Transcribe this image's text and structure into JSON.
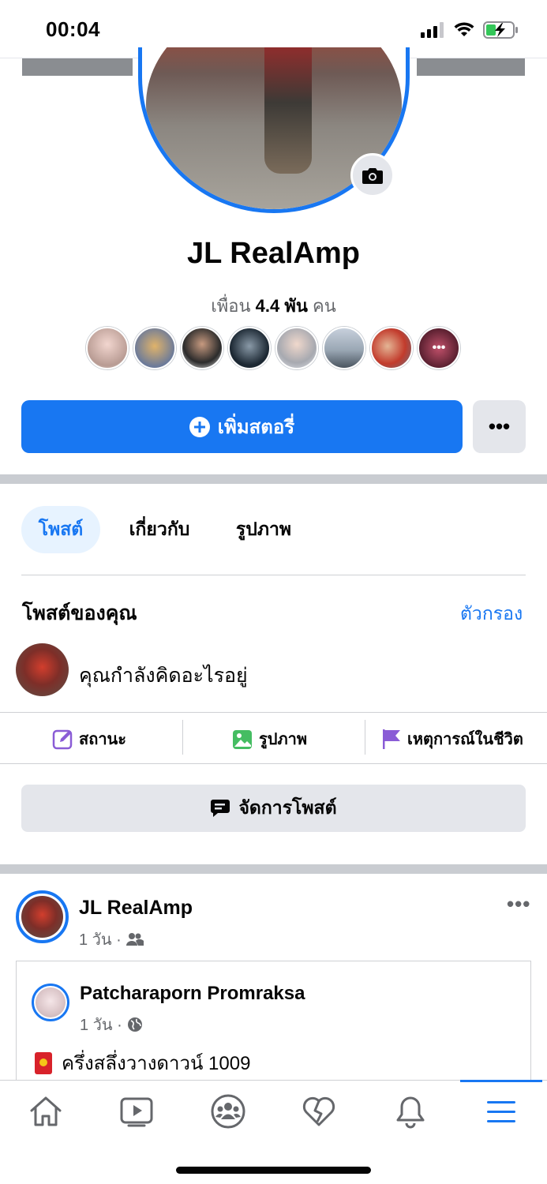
{
  "status_bar": {
    "time": "00:04"
  },
  "profile": {
    "name": "JL RealAmp",
    "friends_prefix": "เพื่อน",
    "friends_count": "4.4 พัน",
    "friends_suffix": "คน",
    "more_friends_label": "•••"
  },
  "buttons": {
    "add_story": "เพิ่มสตอรี่",
    "more": "•••"
  },
  "tabs": [
    {
      "label": "โพสต์",
      "active": true
    },
    {
      "label": "เกี่ยวกับ",
      "active": false
    },
    {
      "label": "รูปภาพ",
      "active": false
    }
  ],
  "posts_section": {
    "title": "โพสต์ของคุณ",
    "filter_label": "ตัวกรอง",
    "composer_placeholder": "คุณกำลังคิดอะไรอยู่"
  },
  "composer_actions": [
    {
      "label": "สถานะ",
      "icon": "edit-icon"
    },
    {
      "label": "รูปภาพ",
      "icon": "photo-icon"
    },
    {
      "label": "เหตุการณ์ในชีวิต",
      "icon": "flag-icon"
    }
  ],
  "manage_posts": "จัดการโพสต์",
  "post": {
    "author": "JL RealAmp",
    "time": "1 วัน ·",
    "more": "•••",
    "shared": {
      "author": "Patcharaporn Promraksa",
      "time": "1 วัน ·",
      "text": "ครึ่งสลึ่งวางดาวน์ 1009"
    }
  },
  "nav": [
    {
      "icon": "home-icon"
    },
    {
      "icon": "watch-icon"
    },
    {
      "icon": "groups-icon"
    },
    {
      "icon": "dating-icon"
    },
    {
      "icon": "notifications-icon"
    },
    {
      "icon": "menu-icon",
      "active": true
    }
  ],
  "colors": {
    "accent": "#1877f2",
    "separator": "#c9ccd1",
    "button_gray": "#e4e6eb"
  }
}
